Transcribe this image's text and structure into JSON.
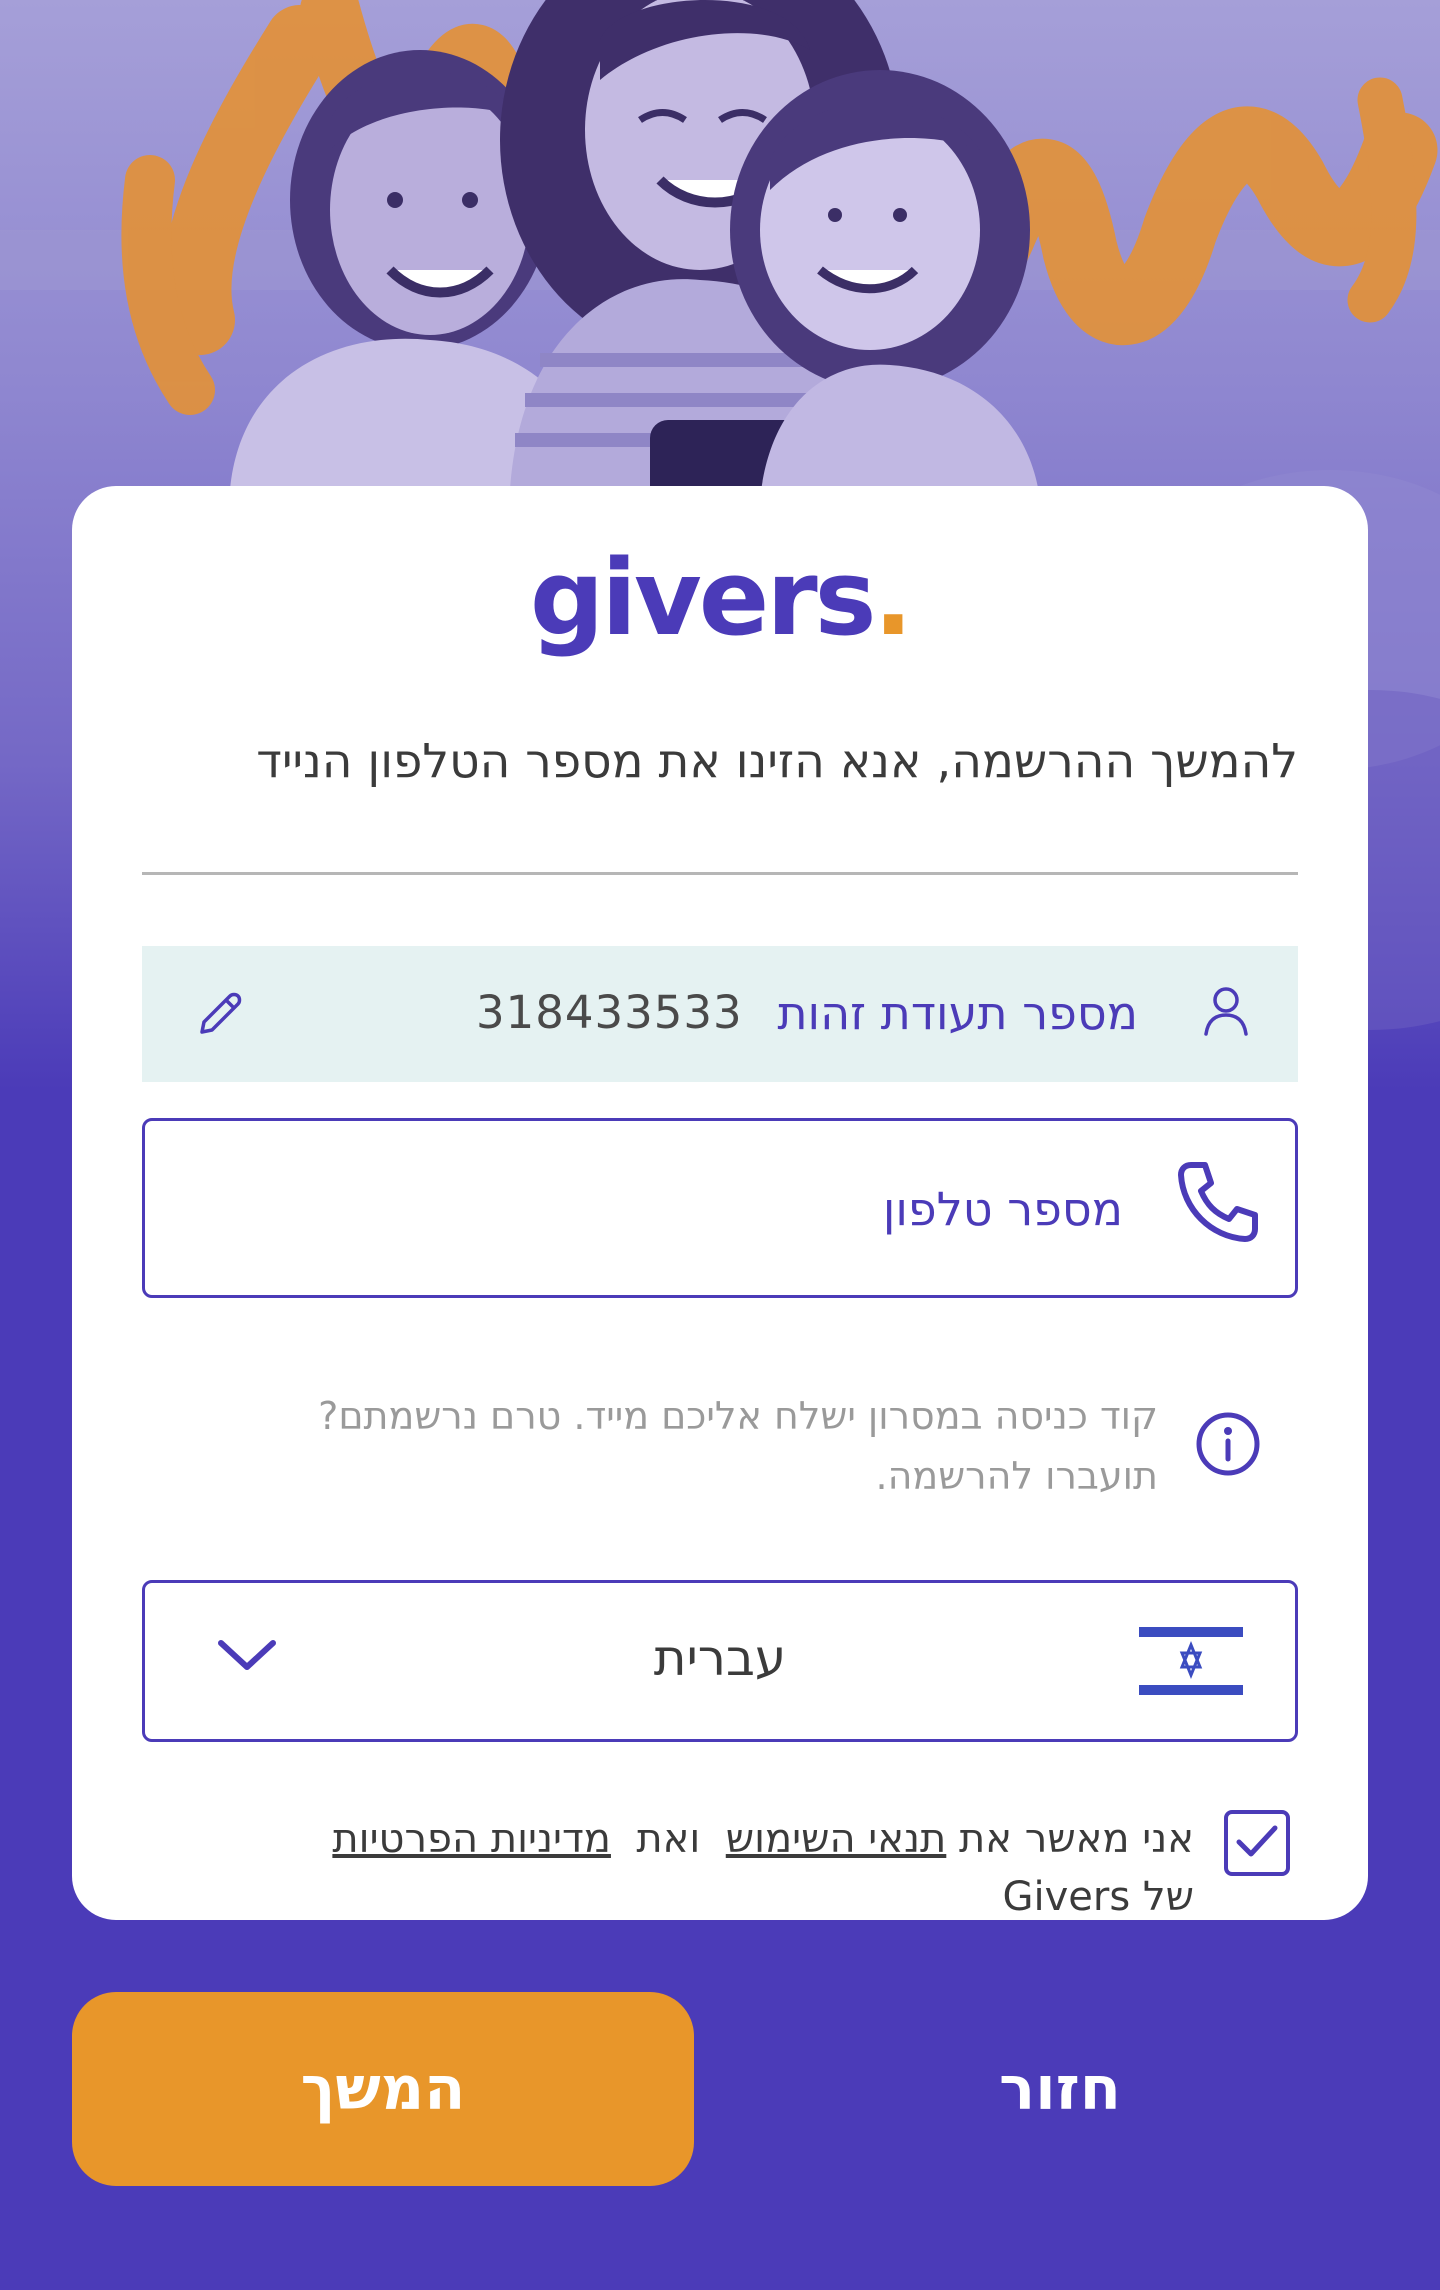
{
  "brand": {
    "name": "givers",
    "dot": ".",
    "colors": {
      "primary": "#4b3bb8",
      "accent": "#e8962a",
      "field_bg": "#e5f2f2"
    }
  },
  "hero": {
    "icon": "family-photo"
  },
  "instruction": "להמשך ההרשמה, אנא הזינו את מספר הטלפון הנייד",
  "id_field": {
    "icon": "user-icon",
    "label": "מספר תעודת זהות",
    "value": "318433533",
    "edit_icon": "pencil-icon"
  },
  "phone_field": {
    "icon": "phone-icon",
    "placeholder": "מספר טלפון",
    "value": ""
  },
  "info": {
    "icon": "info-icon",
    "text": "קוד כניסה במסרון ישלח אליכם מייד. טרם נרשמתם? תועברו להרשמה."
  },
  "language": {
    "flag_icon": "israel-flag-icon",
    "selected": "עברית",
    "chevron_icon": "chevron-down-icon"
  },
  "terms": {
    "checked": true,
    "prefix": "אני מאשר את",
    "terms_link": "תנאי השימוש",
    "middle": "ואת",
    "privacy_link": "מדיניות הפרטיות",
    "suffix": "של Givers"
  },
  "buttons": {
    "continue": "המשך",
    "back": "חזור"
  }
}
